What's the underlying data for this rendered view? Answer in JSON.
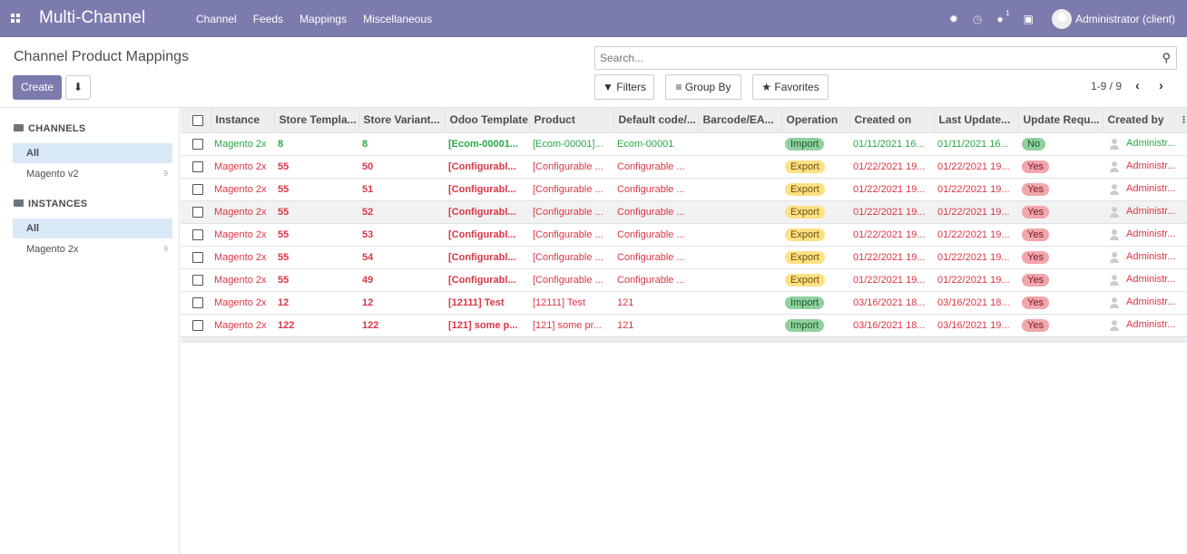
{
  "navbar": {
    "brand": "Multi-Channel",
    "menu": [
      "Channel",
      "Feeds",
      "Mappings",
      "Miscellaneous"
    ],
    "messages_count": "1",
    "user": "Administrator (client)",
    "color": "#7c7bad"
  },
  "control": {
    "title": "Channel Product Mappings",
    "create_label": "Create",
    "search_placeholder": "Search...",
    "filters_label": "Filters",
    "groupby_label": "Group By",
    "favorites_label": "Favorites",
    "pager": "1-9 / 9"
  },
  "sidebar": {
    "channels_title": "CHANNELS",
    "channels": [
      {
        "label": "All",
        "count": ""
      },
      {
        "label": "Magento v2",
        "count": "9"
      }
    ],
    "instances_title": "INSTANCES",
    "instances": [
      {
        "label": "All",
        "count": ""
      },
      {
        "label": "Magento 2x",
        "count": "9"
      }
    ]
  },
  "table": {
    "columns": [
      "Instance",
      "Store Templa...",
      "Store Variant...",
      "Odoo Template",
      "Product",
      "Default code/...",
      "Barcode/EA...",
      "Operation",
      "Created on",
      "Last Update...",
      "Update Requ...",
      "Created by"
    ],
    "rows": [
      {
        "tone": "green",
        "instance": "Magento 2x",
        "store_template": "8",
        "store_variant": "8",
        "odoo_template": "[Ecom-00001...",
        "product": "[Ecom-00001]...",
        "default_code": "Ecom-00001",
        "barcode": "",
        "operation": "Import",
        "created_on": "01/11/2021 16...",
        "last_update": "01/11/2021 16...",
        "update_required": "No",
        "created_by": "Administr..."
      },
      {
        "tone": "red",
        "instance": "Magento 2x",
        "store_template": "55",
        "store_variant": "50",
        "odoo_template": "[Configurabl...",
        "product": "[Configurable ...",
        "default_code": "Configurable ...",
        "barcode": "",
        "operation": "Export",
        "created_on": "01/22/2021 19...",
        "last_update": "01/22/2021 19...",
        "update_required": "Yes",
        "created_by": "Administr..."
      },
      {
        "tone": "red",
        "instance": "Magento 2x",
        "store_template": "55",
        "store_variant": "51",
        "odoo_template": "[Configurabl...",
        "product": "[Configurable ...",
        "default_code": "Configurable ...",
        "barcode": "",
        "operation": "Export",
        "created_on": "01/22/2021 19...",
        "last_update": "01/22/2021 19...",
        "update_required": "Yes",
        "created_by": "Administr..."
      },
      {
        "tone": "red",
        "instance": "Magento 2x",
        "store_template": "55",
        "store_variant": "52",
        "odoo_template": "[Configurabl...",
        "product": "[Configurable ...",
        "default_code": "Configurable ...",
        "barcode": "",
        "operation": "Export",
        "created_on": "01/22/2021 19...",
        "last_update": "01/22/2021 19...",
        "update_required": "Yes",
        "created_by": "Administr..."
      },
      {
        "tone": "red",
        "instance": "Magento 2x",
        "store_template": "55",
        "store_variant": "53",
        "odoo_template": "[Configurabl...",
        "product": "[Configurable ...",
        "default_code": "Configurable ...",
        "barcode": "",
        "operation": "Export",
        "created_on": "01/22/2021 19...",
        "last_update": "01/22/2021 19...",
        "update_required": "Yes",
        "created_by": "Administr..."
      },
      {
        "tone": "red",
        "instance": "Magento 2x",
        "store_template": "55",
        "store_variant": "54",
        "odoo_template": "[Configurabl...",
        "product": "[Configurable ...",
        "default_code": "Configurable ...",
        "barcode": "",
        "operation": "Export",
        "created_on": "01/22/2021 19...",
        "last_update": "01/22/2021 19...",
        "update_required": "Yes",
        "created_by": "Administr..."
      },
      {
        "tone": "red",
        "instance": "Magento 2x",
        "store_template": "55",
        "store_variant": "49",
        "odoo_template": "[Configurabl...",
        "product": "[Configurable ...",
        "default_code": "Configurable ...",
        "barcode": "",
        "operation": "Export",
        "created_on": "01/22/2021 19...",
        "last_update": "01/22/2021 19...",
        "update_required": "Yes",
        "created_by": "Administr..."
      },
      {
        "tone": "red",
        "instance": "Magento 2x",
        "store_template": "12",
        "store_variant": "12",
        "odoo_template": "[12111] Test",
        "product": "[12111] Test",
        "default_code": "121",
        "barcode": "",
        "operation": "Import",
        "created_on": "03/16/2021 18...",
        "last_update": "03/16/2021 18...",
        "update_required": "Yes",
        "created_by": "Administr..."
      },
      {
        "tone": "red",
        "instance": "Magento 2x",
        "store_template": "122",
        "store_variant": "122",
        "odoo_template": "[121] some p...",
        "product": "[121] some pr...",
        "default_code": "121",
        "barcode": "",
        "operation": "Import",
        "created_on": "03/16/2021 18...",
        "last_update": "03/16/2021 19...",
        "update_required": "Yes",
        "created_by": "Administr..."
      }
    ]
  }
}
